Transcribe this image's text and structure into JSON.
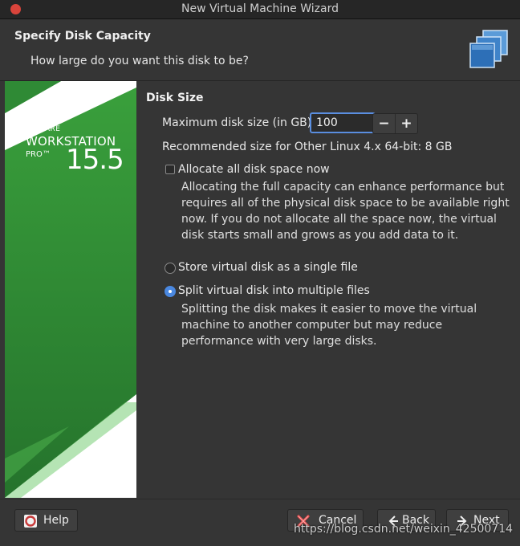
{
  "window": {
    "title": "New Virtual Machine Wizard"
  },
  "header": {
    "title": "Specify Disk Capacity",
    "subtitle": "How large do you want this disk to be?"
  },
  "banner": {
    "brand_top": "VMWARE",
    "product": "WORKSTATION",
    "edition": "PRO™",
    "version": "15.5"
  },
  "disk": {
    "section_title": "Disk Size",
    "max_label": "Maximum disk size (in GB):",
    "max_value": "100",
    "minus": "−",
    "plus": "+",
    "recommended": "Recommended size for Other Linux 4.x 64-bit: 8 GB",
    "allocate_label": "Allocate all disk space now",
    "allocate_checked": false,
    "allocate_desc": "Allocating the full capacity can enhance performance but requires all of the physical disk space to be available right now. If you do not allocate all the space now, the virtual disk starts small and grows as you add data to it.",
    "single_label": "Store virtual disk as a single file",
    "multi_label": "Split virtual disk into multiple files",
    "selected_option": "multi",
    "multi_desc": "Splitting the disk makes it easier to move the virtual machine to another computer but may reduce performance with very large disks."
  },
  "footer": {
    "help": "Help",
    "cancel": "Cancel",
    "back": "Back",
    "next": "Next"
  },
  "watermark": "https://blog.csdn.net/weixin_42500714",
  "colors": {
    "accent": "#4a88e0",
    "banner_green": "#2f8a35",
    "close": "#d9443b"
  }
}
